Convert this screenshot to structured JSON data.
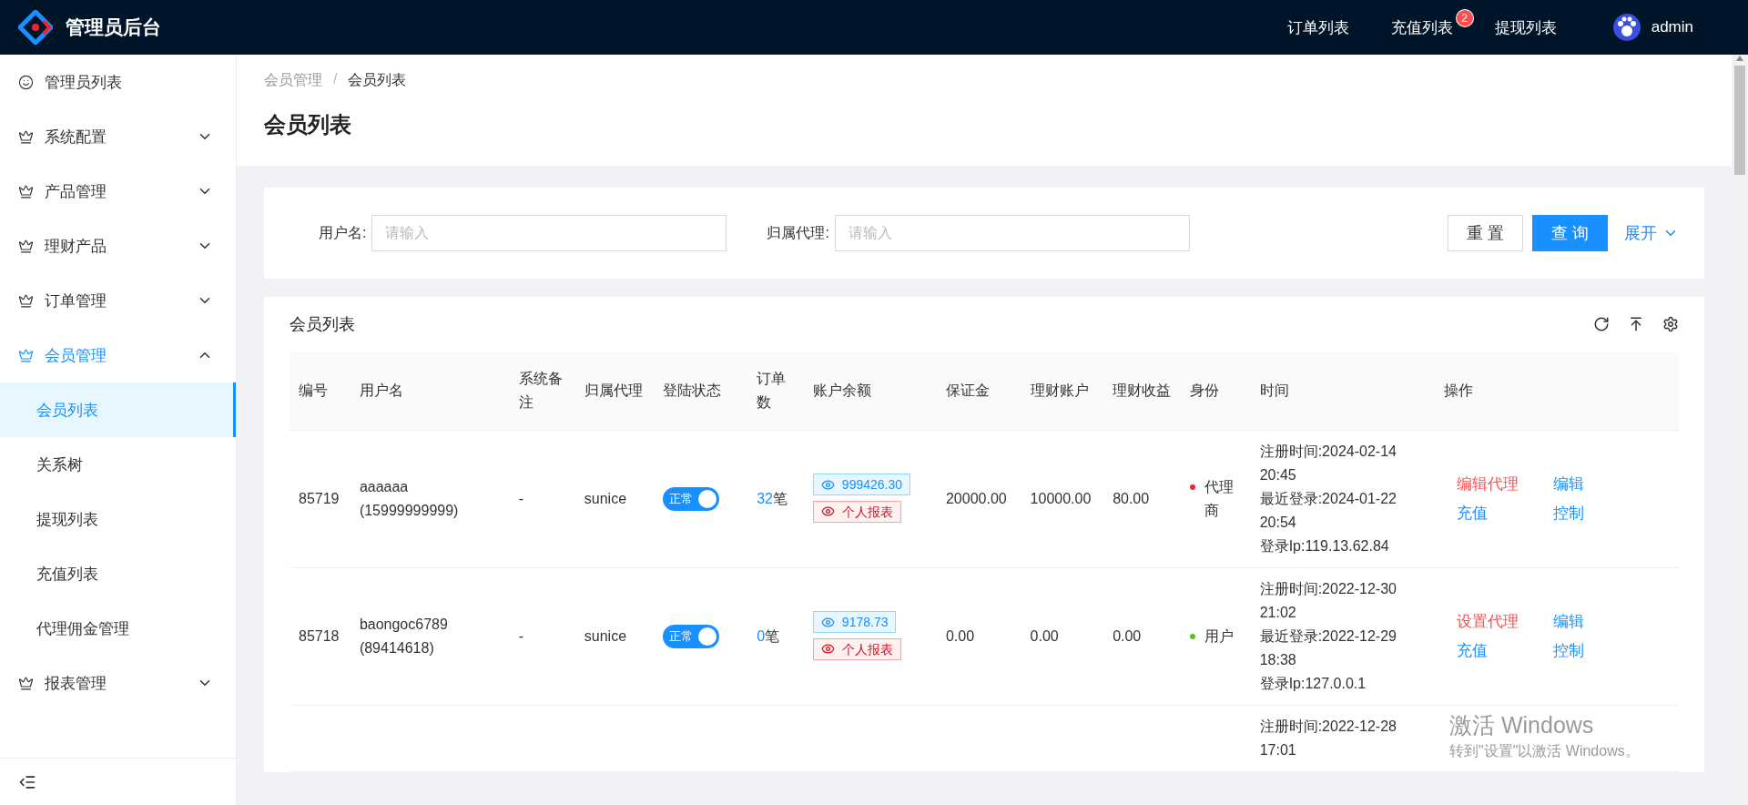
{
  "header": {
    "title": "管理员后台",
    "nav": [
      {
        "label": "订单列表"
      },
      {
        "label": "充值列表",
        "badge": "2"
      },
      {
        "label": "提现列表"
      }
    ],
    "user": "admin"
  },
  "sidebar": {
    "items": [
      {
        "label": "管理员列表",
        "kind": "link",
        "selected": false
      },
      {
        "label": "系统配置",
        "kind": "group",
        "expanded": false
      },
      {
        "label": "产品管理",
        "kind": "group",
        "expanded": false
      },
      {
        "label": "理财产品",
        "kind": "group",
        "expanded": false
      },
      {
        "label": "订单管理",
        "kind": "group",
        "expanded": false
      },
      {
        "label": "会员管理",
        "kind": "group",
        "expanded": true,
        "children": [
          {
            "label": "会员列表",
            "selected": true
          },
          {
            "label": "关系树",
            "selected": false
          },
          {
            "label": "提现列表",
            "selected": false
          },
          {
            "label": "充值列表",
            "selected": false
          },
          {
            "label": "代理佣金管理",
            "selected": false
          }
        ]
      },
      {
        "label": "报表管理",
        "kind": "group",
        "expanded": false
      }
    ]
  },
  "breadcrumb": {
    "items": [
      "会员管理",
      "会员列表"
    ],
    "separator": "/"
  },
  "page_title": "会员列表",
  "search": {
    "fields": [
      {
        "label": "用户名:",
        "placeholder": "请输入"
      },
      {
        "label": "归属代理:",
        "placeholder": "请输入"
      }
    ],
    "reset": "重 置",
    "query": "查 询",
    "expand": "展开"
  },
  "table": {
    "title": "会员列表",
    "columns": [
      "编号",
      "用户名",
      "系统备注",
      "归属代理",
      "登陆状态",
      "订单数",
      "账户余额",
      "保证金",
      "理财账户",
      "理财收益",
      "身份",
      "时间",
      "操作"
    ],
    "rows": [
      {
        "id": "85719",
        "username": "aaaaaa",
        "phone": "(15999999999)",
        "remark": "-",
        "agent": "sunice",
        "login_status": {
          "label": "正常",
          "on": true
        },
        "orders": "32",
        "orders_unit": "笔",
        "balance": "999426.30",
        "report": "个人报表",
        "deposit": "20000.00",
        "wealth_account": "10000.00",
        "wealth_income": "80.00",
        "role": {
          "label": "代理商",
          "color": "#f5222d"
        },
        "time_lines": [
          "注册时间:2024-02-14",
          "20:45",
          "最近登录:2024-01-22",
          "20:54",
          "登录Ip:119.13.62.84"
        ],
        "actions": [
          {
            "label": "编辑代理",
            "kind": "danger"
          },
          {
            "label": "编辑",
            "kind": "link"
          },
          {
            "label": "充值",
            "kind": "link"
          },
          {
            "label": "控制",
            "kind": "link"
          }
        ]
      },
      {
        "id": "85718",
        "username": "baongoc6789",
        "phone": "(89414618)",
        "remark": "-",
        "agent": "sunice",
        "login_status": {
          "label": "正常",
          "on": true
        },
        "orders": "0",
        "orders_unit": "笔",
        "balance": "9178.73",
        "report": "个人报表",
        "deposit": "0.00",
        "wealth_account": "0.00",
        "wealth_income": "0.00",
        "role": {
          "label": "用户",
          "color": "#52c41a"
        },
        "time_lines": [
          "注册时间:2022-12-30",
          "21:02",
          "最近登录:2022-12-29",
          "18:38",
          "登录Ip:127.0.0.1"
        ],
        "actions": [
          {
            "label": "设置代理",
            "kind": "danger"
          },
          {
            "label": "编辑",
            "kind": "link"
          },
          {
            "label": "充值",
            "kind": "link"
          },
          {
            "label": "控制",
            "kind": "link"
          }
        ]
      },
      {
        "time_lines": [
          "注册时间:2022-12-28",
          "17:01"
        ]
      }
    ]
  },
  "activation_notice": {
    "title": "激活 Windows",
    "text": "转到\"设置\"以激活 Windows。"
  }
}
